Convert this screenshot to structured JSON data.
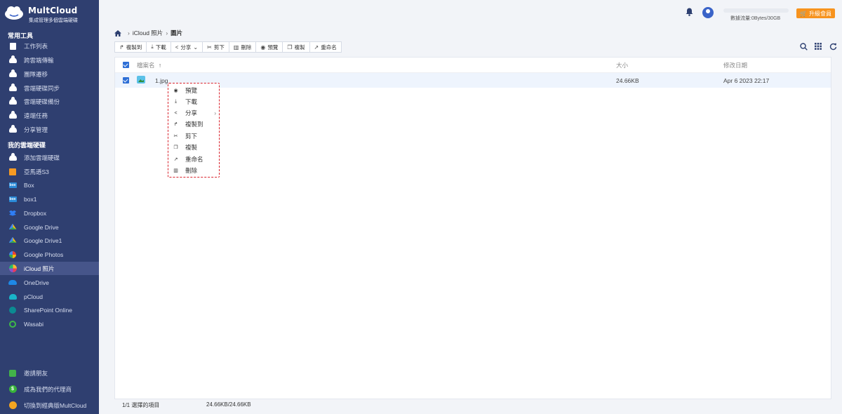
{
  "app": {
    "logo_title": "MultCloud",
    "logo_subtitle": "集成管理多個雲端硬碟"
  },
  "sidebar": {
    "section_common": "常用工具",
    "common_items": [
      {
        "label": "工作列表",
        "icon": "task-list-icon"
      },
      {
        "label": "跨雲端傳輸",
        "icon": "cloud-transfer-icon"
      },
      {
        "label": "團隊遷移",
        "icon": "team-migration-icon"
      },
      {
        "label": "雲端硬碟同步",
        "icon": "cloud-sync-icon"
      },
      {
        "label": "雲端硬碟備份",
        "icon": "cloud-backup-icon"
      },
      {
        "label": "遠端任務",
        "icon": "remote-task-icon"
      },
      {
        "label": "分享管理",
        "icon": "share-manage-icon"
      }
    ],
    "section_drives": "我的雲端硬碟",
    "drive_items": [
      {
        "label": "添加雲端硬碟",
        "icon": "add-cloud-icon"
      },
      {
        "label": "亞馬遜S3",
        "icon": "amazon-s3-icon"
      },
      {
        "label": "Box",
        "icon": "box-icon"
      },
      {
        "label": "box1",
        "icon": "box-icon"
      },
      {
        "label": "Dropbox",
        "icon": "dropbox-icon"
      },
      {
        "label": "Google Drive",
        "icon": "google-drive-icon"
      },
      {
        "label": "Google Drive1",
        "icon": "google-drive-icon"
      },
      {
        "label": "Google Photos",
        "icon": "google-photos-icon"
      },
      {
        "label": "iCloud 照片",
        "icon": "icloud-photos-icon"
      },
      {
        "label": "OneDrive",
        "icon": "onedrive-icon"
      },
      {
        "label": "pCloud",
        "icon": "pcloud-icon"
      },
      {
        "label": "SharePoint Online",
        "icon": "sharepoint-icon"
      },
      {
        "label": "Wasabi",
        "icon": "wasabi-icon"
      }
    ],
    "bottom_items": [
      {
        "label": "邀請朋友",
        "icon": "gift-icon"
      },
      {
        "label": "成為我們的代理商",
        "icon": "dollar-icon"
      },
      {
        "label": "切換到經典版MultCloud",
        "icon": "switch-icon"
      }
    ]
  },
  "header": {
    "quota_text": "數據流量:0Bytes/30GB",
    "upgrade_label": "升級會員",
    "accent_color": "#f7931e"
  },
  "breadcrumb": {
    "parent": "iCloud 照片",
    "current": "圖片"
  },
  "toolbar": {
    "copy_to": "複製到",
    "download": "下載",
    "share": "分享",
    "cut": "剪下",
    "delete": "刪除",
    "preview": "預覽",
    "copy": "複製",
    "rename": "重命名"
  },
  "table": {
    "col_name": "檔案名",
    "col_size": "大小",
    "col_modified": "修改日期",
    "rows": [
      {
        "name": "1.jpg",
        "size": "24.66KB",
        "modified": "Apr 6 2023 22:17"
      }
    ]
  },
  "context_menu": {
    "items": [
      "預覽",
      "下載",
      "分享",
      "複製到",
      "剪下",
      "複製",
      "重命名",
      "刪除"
    ]
  },
  "footer": {
    "selection": "1/1 選擇的項目",
    "size": "24.66KB/24.66KB"
  }
}
